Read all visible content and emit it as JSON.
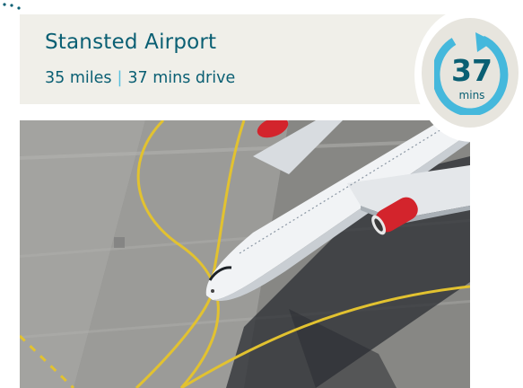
{
  "destination": {
    "name": "Stansted Airport",
    "distance": "35 miles",
    "separator": "|",
    "drive_time": "37 mins drive"
  },
  "badge": {
    "value": "37",
    "unit": "mins",
    "icon": "refresh-arrow-icon"
  },
  "photo": {
    "subject": "airplane-photo"
  },
  "colors": {
    "accent": "#0a5f73",
    "ring": "#45b8dc",
    "panel": "#f0efe9",
    "separator": "#57c0e0"
  }
}
